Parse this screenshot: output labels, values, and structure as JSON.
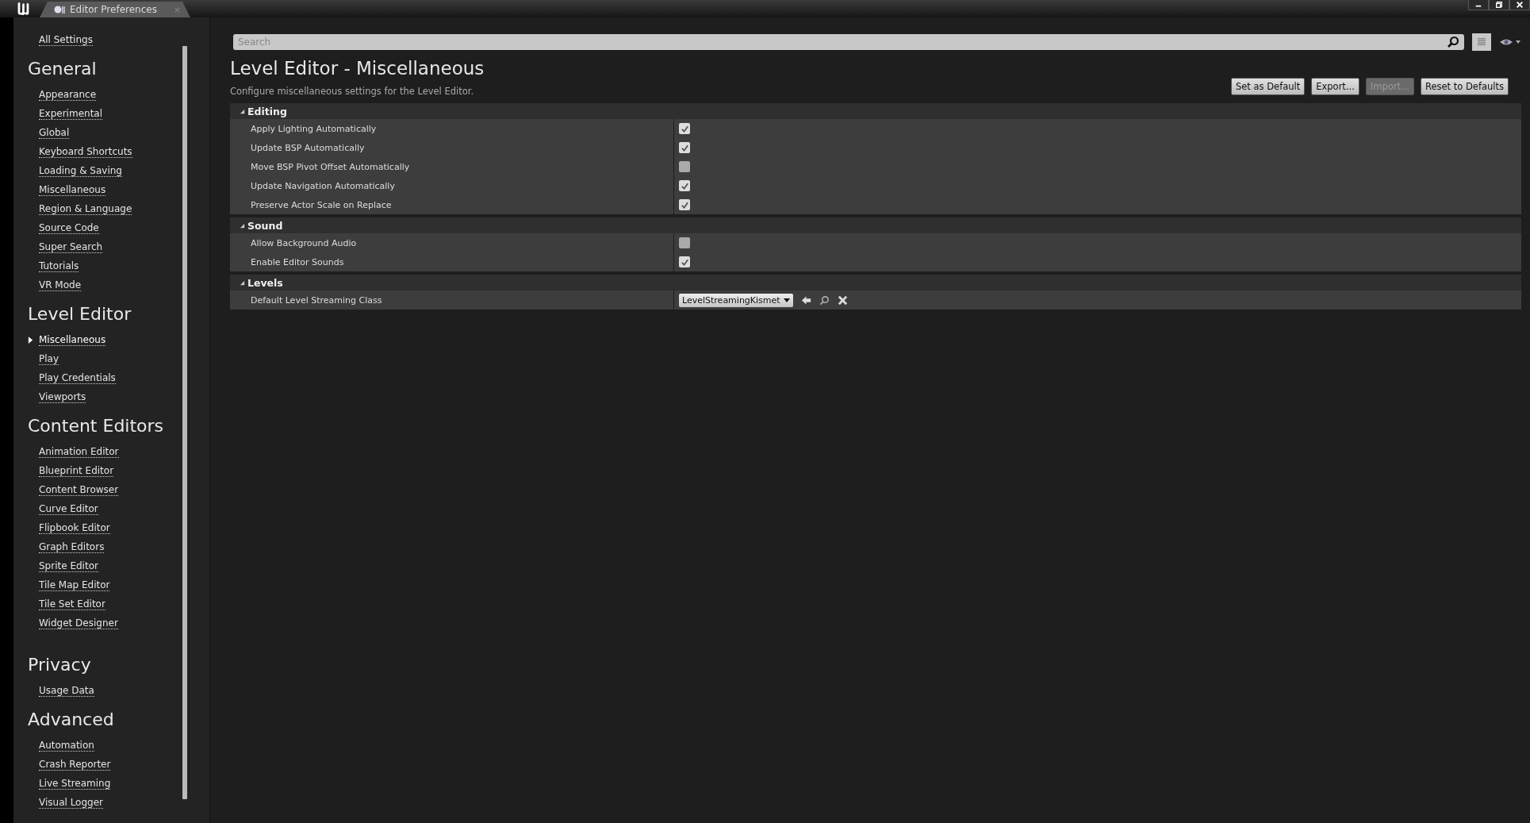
{
  "window": {
    "tab_title": "Editor Preferences",
    "tab_close": "×"
  },
  "sidebar": {
    "top_link": {
      "label": "All Settings",
      "selected": false
    },
    "groups": [
      {
        "title": "General",
        "items": [
          {
            "label": "Appearance",
            "selected": false
          },
          {
            "label": "Experimental",
            "selected": false
          },
          {
            "label": "Global",
            "selected": false
          },
          {
            "label": "Keyboard Shortcuts",
            "selected": false
          },
          {
            "label": "Loading & Saving",
            "selected": false
          },
          {
            "label": "Miscellaneous",
            "selected": false
          },
          {
            "label": "Region & Language",
            "selected": false
          },
          {
            "label": "Source Code",
            "selected": false
          },
          {
            "label": "Super Search",
            "selected": false
          },
          {
            "label": "Tutorials",
            "selected": false
          },
          {
            "label": "VR Mode",
            "selected": false
          }
        ]
      },
      {
        "title": "Level Editor",
        "items": [
          {
            "label": "Miscellaneous",
            "selected": true
          },
          {
            "label": "Play",
            "selected": false
          },
          {
            "label": "Play Credentials",
            "selected": false
          },
          {
            "label": "Viewports",
            "selected": false
          }
        ]
      },
      {
        "title": "Content Editors",
        "items": [
          {
            "label": "Animation Editor",
            "selected": false
          },
          {
            "label": "Blueprint Editor",
            "selected": false
          },
          {
            "label": "Content Browser",
            "selected": false
          },
          {
            "label": "Curve Editor",
            "selected": false
          },
          {
            "label": "Flipbook Editor",
            "selected": false
          },
          {
            "label": "Graph Editors",
            "selected": false
          },
          {
            "label": "Sprite Editor",
            "selected": false
          },
          {
            "label": "Tile Map Editor",
            "selected": false
          },
          {
            "label": "Tile Set Editor",
            "selected": false
          },
          {
            "label": "Widget Designer",
            "selected": false
          }
        ]
      },
      {
        "title": "Privacy",
        "items": [
          {
            "label": "Usage Data",
            "selected": false
          }
        ]
      },
      {
        "title": "Advanced",
        "items": [
          {
            "label": "Automation",
            "selected": false
          },
          {
            "label": "Crash Reporter",
            "selected": false
          },
          {
            "label": "Live Streaming",
            "selected": false
          },
          {
            "label": "Visual Logger",
            "selected": false
          }
        ]
      }
    ]
  },
  "search": {
    "placeholder": "Search"
  },
  "header": {
    "title": "Level Editor - Miscellaneous",
    "description": "Configure miscellaneous settings for the Level Editor."
  },
  "buttons": [
    {
      "label": "Set as Default",
      "disabled": false
    },
    {
      "label": "Export...",
      "disabled": false
    },
    {
      "label": "Import...",
      "disabled": true
    },
    {
      "label": "Reset to Defaults",
      "disabled": false
    }
  ],
  "sections": [
    {
      "title": "Editing",
      "expanded": true,
      "rows": [
        {
          "kind": "checkbox",
          "label": "Apply Lighting Automatically",
          "checked": true
        },
        {
          "kind": "checkbox",
          "label": "Update BSP Automatically",
          "checked": true
        },
        {
          "kind": "checkbox",
          "label": "Move BSP Pivot Offset Automatically",
          "checked": false
        },
        {
          "kind": "checkbox",
          "label": "Update Navigation Automatically",
          "checked": true
        },
        {
          "kind": "checkbox",
          "label": "Preserve Actor Scale on Replace",
          "checked": true
        }
      ]
    },
    {
      "title": "Sound",
      "expanded": true,
      "rows": [
        {
          "kind": "checkbox",
          "label": "Allow Background Audio",
          "checked": false
        },
        {
          "kind": "checkbox",
          "label": "Enable Editor Sounds",
          "checked": true
        }
      ]
    },
    {
      "title": "Levels",
      "expanded": true,
      "rows": [
        {
          "kind": "class_picker",
          "label": "Default Level Streaming Class",
          "value": "LevelStreamingKismet"
        }
      ]
    }
  ]
}
